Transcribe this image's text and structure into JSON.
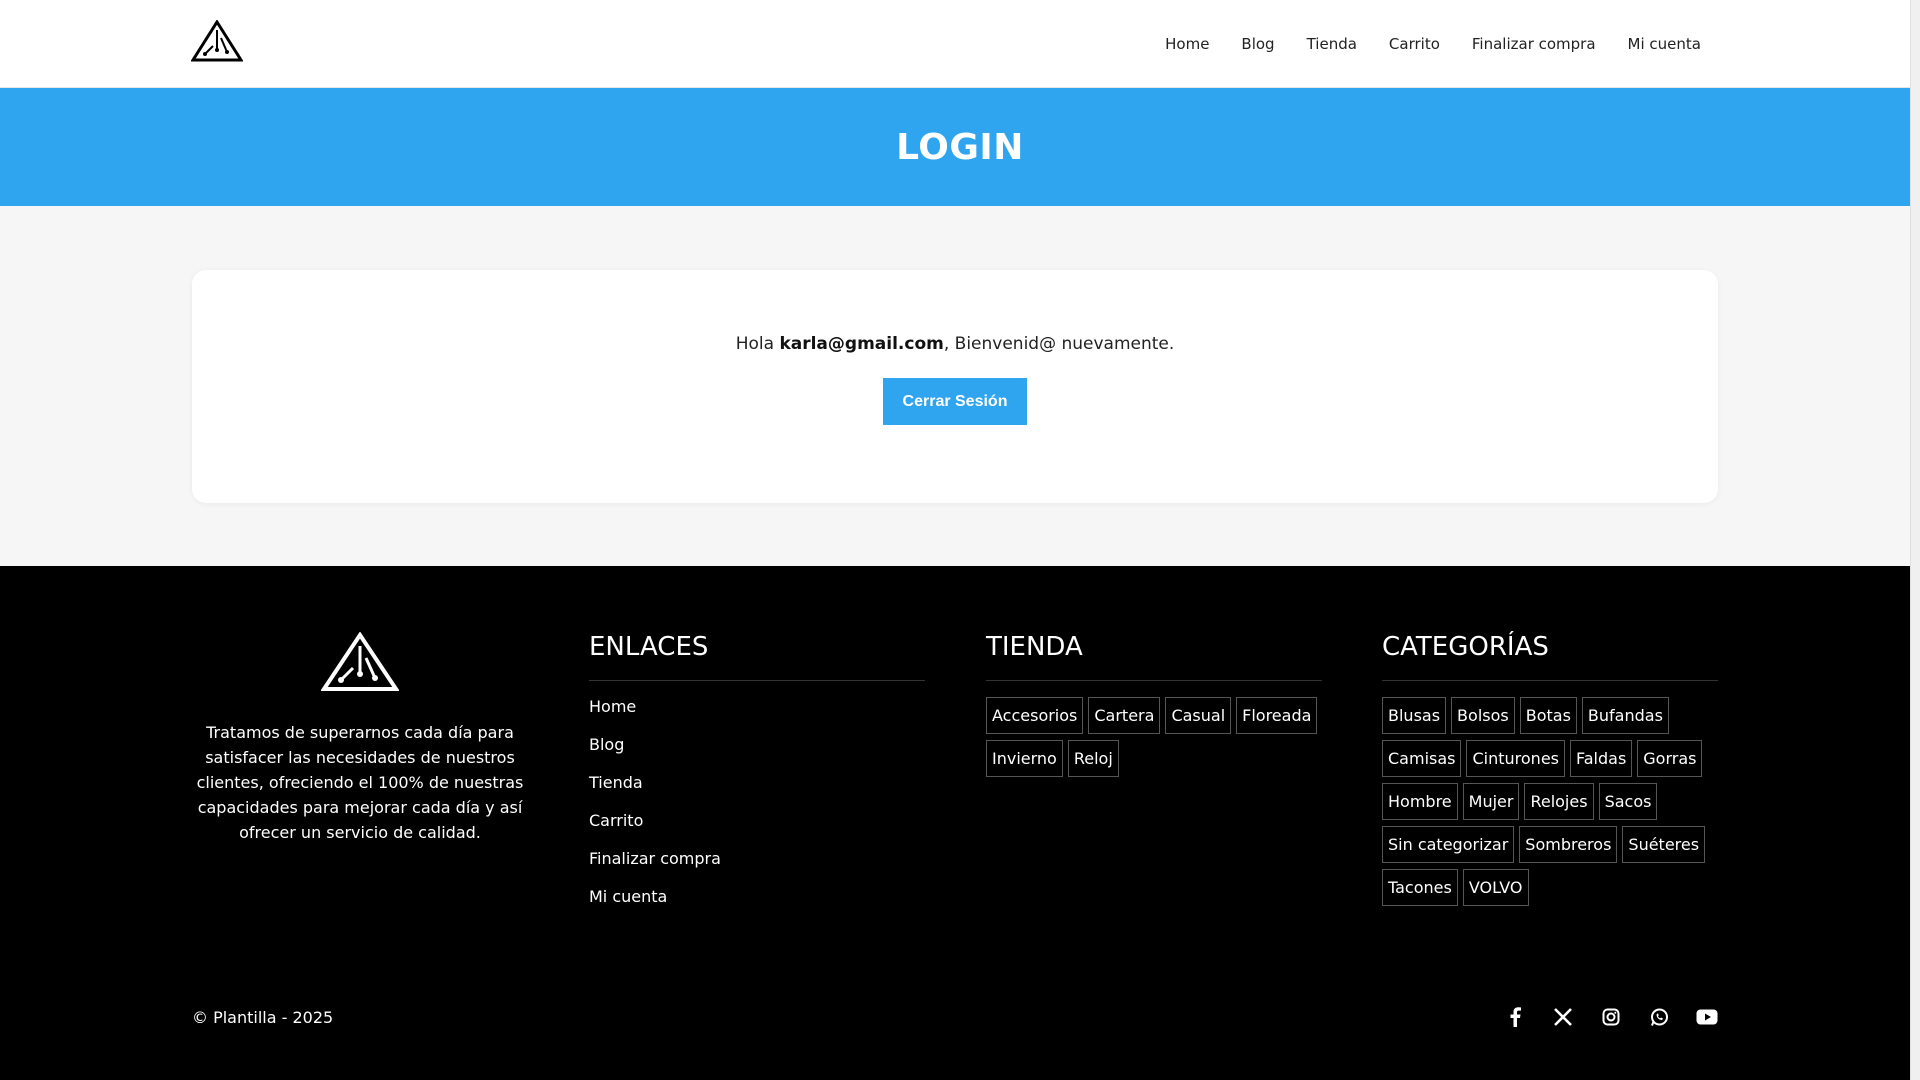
{
  "nav": [
    "Home",
    "Blog",
    "Tienda",
    "Carrito",
    "Finalizar compra",
    "Mi cuenta"
  ],
  "hero": {
    "title": "LOGIN"
  },
  "account": {
    "greeting_prefix": "Hola ",
    "email": "karla@gmail.com",
    "greeting_suffix": ", Bienvenid@ nuevamente.",
    "logout_label": "Cerrar Sesión"
  },
  "footer": {
    "about": "Tratamos de superarnos cada día para satisfacer las necesidades de nuestros clientes, ofreciendo el 100% de nuestras capacidades para mejorar cada día y así ofrecer un servicio de calidad.",
    "links_title": "ENLACES",
    "links": [
      "Home",
      "Blog",
      "Tienda",
      "Carrito",
      "Finalizar compra",
      "Mi cuenta"
    ],
    "shop_title": "TIENDA",
    "shop_tags": [
      "Accesorios",
      "Cartera",
      "Casual",
      "Floreada",
      "Invierno",
      "Reloj"
    ],
    "cats_title": "CATEGORÍAS",
    "cat_tags": [
      "Blusas",
      "Bolsos",
      "Botas",
      "Bufandas",
      "Camisas",
      "Cinturones",
      "Faldas",
      "Gorras",
      "Hombre",
      "Mujer",
      "Relojes",
      "Sacos",
      "Sin categorizar",
      "Sombreros",
      "Suéteres",
      "Tacones",
      "VOLVO"
    ],
    "copyright": "© Plantilla - 2025",
    "social_icons": [
      "facebook-icon",
      "x-icon",
      "instagram-icon",
      "whatsapp-icon",
      "youtube-icon"
    ]
  },
  "colors": {
    "accent": "#2fa4ef",
    "footer_bg": "#000000",
    "main_bg": "#f6f6f6"
  }
}
